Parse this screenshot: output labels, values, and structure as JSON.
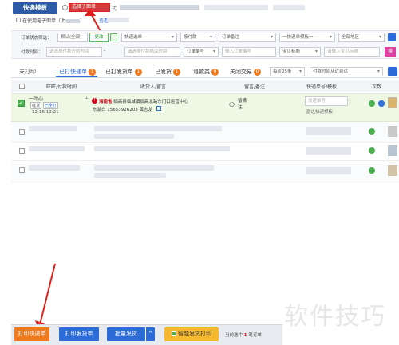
{
  "header": {
    "logo_text": "快递模板",
    "checkbox_label": "在使用电子面单（",
    "checkbox_label_tail": "）",
    "highlight_text": "选择了面单",
    "extra_text": "式",
    "link_text": "查看"
  },
  "filters": {
    "row1_label": "订单状态筛选：",
    "status_value": "默认(全部)",
    "status_button": "更改",
    "select_a": "快递选单",
    "select_b": "按付款",
    "select_c": "订单备注",
    "select_d": "一快递单模板一",
    "select_e": "全部地区",
    "row2_label": "付款时间：",
    "date_from_placeholder": "请选择付款开始时间",
    "date_to_placeholder": "请选择付款结束时间",
    "order_no_label": "订单编号",
    "order_no_placeholder": "输入订单编号",
    "seller_flag": "宝贝标题",
    "keyword_placeholder": "请输入宝贝标题",
    "search_button": "搜"
  },
  "tabs": [
    {
      "label": "未打印",
      "count": "1"
    },
    {
      "label": "已打快递单",
      "count": "1"
    },
    {
      "label": "已打发货单",
      "count": "1"
    },
    {
      "label": "已发货",
      "count": "1"
    },
    {
      "label": "退款类",
      "count": "0"
    },
    {
      "label": "关闭交易",
      "count": "0"
    },
    {
      "label": "每页25条"
    },
    {
      "label": "付款时间从近到远"
    }
  ],
  "table": {
    "headers": [
      "旺旺/付款时间",
      "收货人/留言",
      "留言/备注",
      "快递单号/模板",
      "次数"
    ],
    "row1": {
      "buyer": "一叶心",
      "tag_a": "催货",
      "tag_b": "已全打",
      "time": "12-16 12:21",
      "province": "海南省",
      "address": "临高县临城镇临高北路东门口运营中心",
      "phone": "东湖白 15653926203 黄志龙",
      "remark_a": "留",
      "remark_b": "備",
      "remark_c": "注",
      "tracking_placeholder": "快递单号",
      "tracking_template": "韵达快递模板"
    }
  },
  "footer": {
    "print_express": "打印快递单",
    "print_delivery": "打印发货单",
    "batch_ship": "批量发货",
    "toggle": "^",
    "smart_ship": "智能发货打印",
    "status_prefix": "当前选中",
    "status_count": "1",
    "status_suffix": "笔订单"
  },
  "watermark": "软件技巧",
  "colors": {
    "accent_orange": "#f07a1e",
    "header_blue": "#2b6cd9",
    "annotation_red": "#e0201c",
    "row_green": "#eef8e4"
  }
}
